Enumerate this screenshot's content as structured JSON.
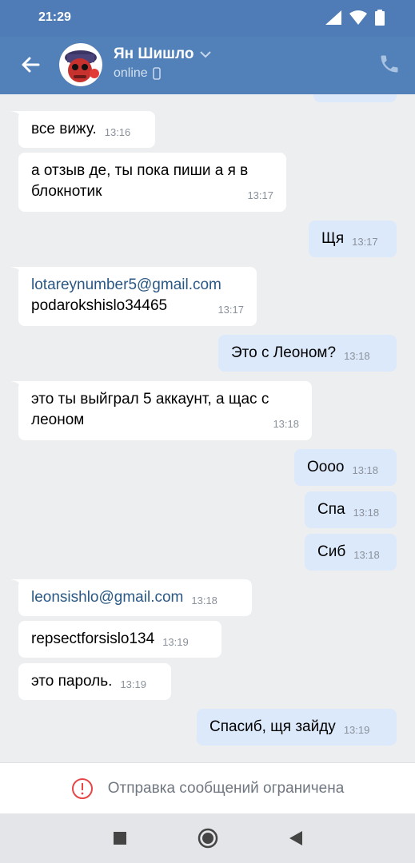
{
  "status_bar": {
    "time": "21:29"
  },
  "header": {
    "contact_name": "Ян Шишло",
    "contact_status": "online"
  },
  "messages": [
    {
      "dir": "in",
      "lines": [
        "все вижу."
      ],
      "time": "13:16"
    },
    {
      "dir": "in",
      "lines": [
        "а отзыв де, ты пока пиши а я в",
        "блокнотик"
      ],
      "time": "13:17"
    },
    {
      "dir": "out",
      "lines": [
        "Щя"
      ],
      "time": "13:17"
    },
    {
      "dir": "in",
      "lines": [
        "lotareynumber5@gmail.com",
        "podarokshislo34465"
      ],
      "time": "13:17"
    },
    {
      "dir": "out",
      "lines": [
        "Это с Леоном?"
      ],
      "time": "13:18"
    },
    {
      "dir": "in",
      "lines": [
        "это ты выйграл 5 аккаунт, а щас с",
        "леоном"
      ],
      "time": "13:18"
    },
    {
      "dir": "out",
      "lines": [
        "Оооо"
      ],
      "time": "13:18"
    },
    {
      "dir": "out",
      "lines": [
        "Спа"
      ],
      "time": "13:18"
    },
    {
      "dir": "out",
      "lines": [
        "Сиб"
      ],
      "time": "13:18"
    },
    {
      "dir": "in",
      "lines": [
        "leonsishlo@gmail.com"
      ],
      "time": "13:18"
    },
    {
      "dir": "in",
      "lines": [
        "repsectforsislo134"
      ],
      "time": "13:19"
    },
    {
      "dir": "in",
      "lines": [
        "это пароль."
      ],
      "time": "13:19"
    },
    {
      "dir": "out",
      "lines": [
        "Спасиб, щя зайду"
      ],
      "time": "13:19"
    }
  ],
  "restriction": {
    "text": "Отправка сообщений ограничена"
  },
  "colors": {
    "header": "#5181b8",
    "status_bar": "#4f7bb6",
    "incoming": "#ffffff",
    "outgoing": "#dce9fa",
    "link": "#2a5885",
    "warning": "#e64646"
  }
}
